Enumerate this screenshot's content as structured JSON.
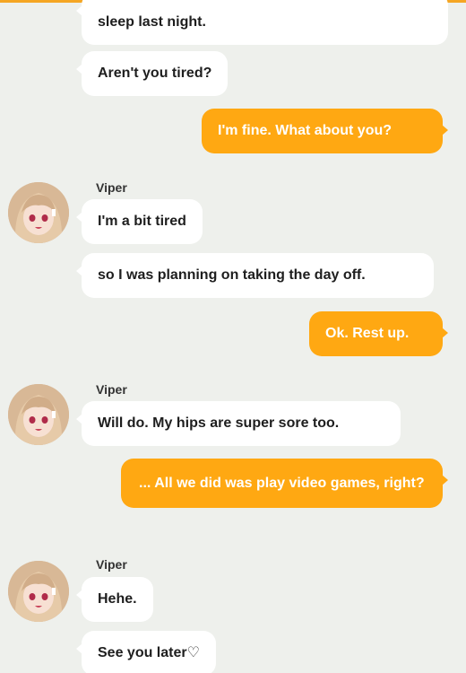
{
  "chat": {
    "messages": [
      {
        "side": "in",
        "text": "sleep last night."
      },
      {
        "side": "in",
        "text": "Aren't you tired?"
      },
      {
        "side": "out",
        "text": "I'm fine. What about you?"
      },
      {
        "side": "in",
        "sender": "Viper",
        "text": "I'm a bit tired"
      },
      {
        "side": "in",
        "text": "so I was planning on taking the day off."
      },
      {
        "side": "out",
        "text": "Ok. Rest up."
      },
      {
        "side": "in",
        "sender": "Viper",
        "text": "Will do. My hips are super sore too."
      },
      {
        "side": "out",
        "text": "... All we did was play video games, right?"
      },
      {
        "side": "in",
        "sender": "Viper",
        "text": "Hehe."
      },
      {
        "side": "in",
        "text": "See you later♡"
      }
    ]
  },
  "colors": {
    "background": "#eef0ec",
    "outgoing_bubble": "#ffa812",
    "incoming_bubble": "#ffffff",
    "accent": "#f5a623"
  },
  "icons": {
    "avatar": "viper-avatar"
  }
}
